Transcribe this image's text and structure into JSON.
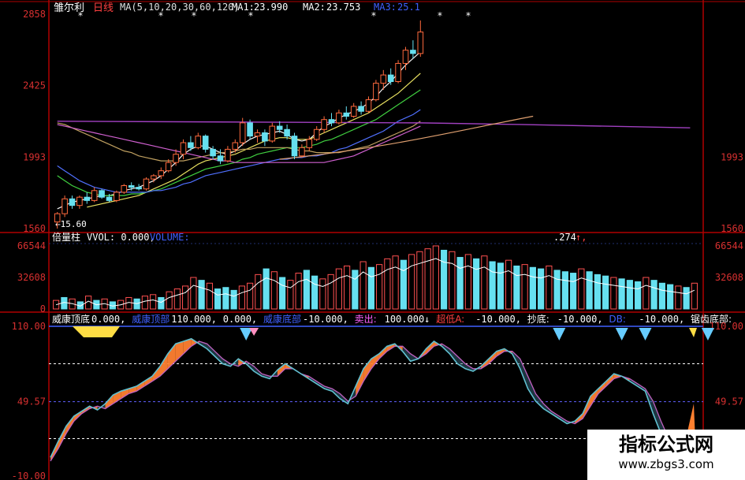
{
  "colors": {
    "bg": "#000000",
    "frame": "#b00000",
    "axis_text": "#d83030",
    "up": "#ff6a3d",
    "down": "#66e0f0",
    "ma5": "#f2f2f2",
    "ma10": "#e8e060",
    "ma20": "#d060d0",
    "ma30": "#40d040",
    "ma60": "#5070ff",
    "ma120": "#c0a060",
    "flat": "#a040c0",
    "kdj_a": "#60c0d0",
    "kdj_b": "#c060c0",
    "fill": "#ff8030",
    "signal": "#66ccff",
    "top_mark": "#ffdd44"
  },
  "header": {
    "stock": "雏尔利",
    "period": "日线",
    "ma_params": "MA(5,10,20,30,60,120)",
    "ma1_label": "MA1:",
    "ma1_value": "23.990",
    "ma2_label": "MA2:",
    "ma2_value": "23.753",
    "ma3_label": "MA3:",
    "ma3_value": "25.1",
    "low_marker": "←15.60"
  },
  "volume_header": {
    "name": "倍量柱",
    "vvol": "VVOL: 0.000,",
    "volume_label": "VOLUME:",
    "right_value": ".274",
    "arrow": "↑,"
  },
  "indicator_header": {
    "items": [
      {
        "label": "威康顶底",
        "value": "0.000,",
        "color": "#ffffff"
      },
      {
        "label": "威康顶部",
        "value": "110.000,",
        "color": "#4060ff"
      },
      {
        "label": "",
        "value": "0.000,",
        "color": "#ffffff"
      },
      {
        "label": "威康底部",
        "value": "-10.000,",
        "color": "#4060ff"
      },
      {
        "label": "卖出:",
        "value": "100.000↓",
        "color": "#ff60ff"
      },
      {
        "label": "超低A:",
        "value": "-10.000,",
        "color": "#ff4040"
      },
      {
        "label": "抄底:",
        "value": "-10.000,",
        "color": "#ffffff"
      },
      {
        "label": "DB:",
        "value": "-10.000,",
        "color": "#4060ff"
      },
      {
        "label": "锯齿底部:",
        "value": "",
        "color": "#ffffff"
      }
    ]
  },
  "watermark": {
    "title": "指标公式网",
    "url": "www.zbgs3.com"
  },
  "chart_data": [
    {
      "type": "candlestick",
      "panel": "price",
      "yticks": [
        "2858",
        "2425",
        "1993",
        "1560"
      ],
      "ylim": [
        15.6,
        28.58
      ],
      "grid": false,
      "candles": [
        {
          "o": 16.0,
          "h": 16.6,
          "l": 15.6,
          "c": 16.5
        },
        {
          "o": 16.5,
          "h": 17.6,
          "l": 16.3,
          "c": 17.4
        },
        {
          "o": 17.4,
          "h": 17.6,
          "l": 16.8,
          "c": 17.0
        },
        {
          "o": 17.0,
          "h": 17.6,
          "l": 16.8,
          "c": 17.5
        },
        {
          "o": 17.5,
          "h": 17.8,
          "l": 17.1,
          "c": 17.3
        },
        {
          "o": 17.3,
          "h": 18.1,
          "l": 17.2,
          "c": 17.9
        },
        {
          "o": 17.9,
          "h": 18.0,
          "l": 17.4,
          "c": 17.5
        },
        {
          "o": 17.5,
          "h": 17.7,
          "l": 17.2,
          "c": 17.3
        },
        {
          "o": 17.3,
          "h": 17.9,
          "l": 17.2,
          "c": 17.8
        },
        {
          "o": 17.8,
          "h": 18.3,
          "l": 17.7,
          "c": 18.2
        },
        {
          "o": 18.2,
          "h": 18.4,
          "l": 17.9,
          "c": 18.1
        },
        {
          "o": 18.1,
          "h": 18.3,
          "l": 17.9,
          "c": 18.0
        },
        {
          "o": 18.0,
          "h": 18.7,
          "l": 17.9,
          "c": 18.6
        },
        {
          "o": 18.6,
          "h": 18.9,
          "l": 18.4,
          "c": 18.8
        },
        {
          "o": 18.8,
          "h": 19.3,
          "l": 18.6,
          "c": 19.1
        },
        {
          "o": 19.1,
          "h": 19.8,
          "l": 19.0,
          "c": 19.6
        },
        {
          "o": 19.6,
          "h": 20.4,
          "l": 19.4,
          "c": 20.1
        },
        {
          "o": 20.1,
          "h": 21.0,
          "l": 19.8,
          "c": 20.8
        },
        {
          "o": 20.8,
          "h": 21.2,
          "l": 20.3,
          "c": 20.5
        },
        {
          "o": 20.5,
          "h": 21.4,
          "l": 20.4,
          "c": 21.2
        },
        {
          "o": 21.2,
          "h": 21.3,
          "l": 20.2,
          "c": 20.4
        },
        {
          "o": 20.4,
          "h": 20.6,
          "l": 19.8,
          "c": 20.0
        },
        {
          "o": 20.0,
          "h": 20.4,
          "l": 19.5,
          "c": 19.7
        },
        {
          "o": 19.7,
          "h": 20.6,
          "l": 19.6,
          "c": 20.4
        },
        {
          "o": 20.4,
          "h": 21.0,
          "l": 20.2,
          "c": 20.8
        },
        {
          "o": 20.8,
          "h": 22.3,
          "l": 20.6,
          "c": 22.0
        },
        {
          "o": 22.0,
          "h": 22.2,
          "l": 21.0,
          "c": 21.2
        },
        {
          "o": 21.2,
          "h": 21.6,
          "l": 20.8,
          "c": 21.4
        },
        {
          "o": 21.4,
          "h": 21.6,
          "l": 20.6,
          "c": 20.9
        },
        {
          "o": 20.9,
          "h": 22.0,
          "l": 20.8,
          "c": 21.8
        },
        {
          "o": 21.8,
          "h": 22.1,
          "l": 21.4,
          "c": 21.6
        },
        {
          "o": 21.6,
          "h": 21.9,
          "l": 21.0,
          "c": 21.2
        },
        {
          "o": 21.2,
          "h": 21.4,
          "l": 19.8,
          "c": 20.0
        },
        {
          "o": 20.0,
          "h": 20.7,
          "l": 19.9,
          "c": 20.5
        },
        {
          "o": 20.5,
          "h": 21.2,
          "l": 20.3,
          "c": 21.0
        },
        {
          "o": 21.0,
          "h": 21.8,
          "l": 20.9,
          "c": 21.6
        },
        {
          "o": 21.6,
          "h": 22.4,
          "l": 21.4,
          "c": 22.2
        },
        {
          "o": 22.2,
          "h": 22.6,
          "l": 21.8,
          "c": 22.0
        },
        {
          "o": 22.0,
          "h": 22.8,
          "l": 21.9,
          "c": 22.6
        },
        {
          "o": 22.6,
          "h": 23.0,
          "l": 22.2,
          "c": 22.4
        },
        {
          "o": 22.4,
          "h": 23.2,
          "l": 22.3,
          "c": 23.0
        },
        {
          "o": 23.0,
          "h": 23.3,
          "l": 22.5,
          "c": 22.7
        },
        {
          "o": 22.7,
          "h": 23.6,
          "l": 22.6,
          "c": 23.4
        },
        {
          "o": 23.4,
          "h": 24.6,
          "l": 23.3,
          "c": 24.4
        },
        {
          "o": 24.4,
          "h": 25.2,
          "l": 24.0,
          "c": 24.9
        },
        {
          "o": 24.9,
          "h": 25.3,
          "l": 24.3,
          "c": 24.5
        },
        {
          "o": 24.5,
          "h": 25.8,
          "l": 24.4,
          "c": 25.6
        },
        {
          "o": 25.6,
          "h": 26.6,
          "l": 25.2,
          "c": 26.4
        },
        {
          "o": 26.4,
          "h": 27.0,
          "l": 25.9,
          "c": 26.2
        },
        {
          "o": 26.2,
          "h": 28.2,
          "l": 26.0,
          "c": 27.5
        }
      ],
      "ma_series": [
        {
          "name": "MA1",
          "values": [
            16.8,
            17.0,
            17.2,
            17.3,
            17.4,
            17.5,
            17.6,
            17.6,
            17.7,
            17.9,
            18.0,
            18.1,
            18.3,
            18.5,
            18.8,
            19.2,
            19.6,
            20.1,
            20.4,
            20.6,
            20.6,
            20.4,
            20.2,
            20.1,
            20.3,
            20.7,
            21.0,
            21.2,
            21.3,
            21.4,
            21.5,
            21.3,
            21.0,
            20.9,
            21.0,
            21.4,
            21.8,
            22.0,
            22.3,
            22.5,
            22.7,
            22.9,
            23.2,
            23.6,
            24.1,
            24.5,
            25.0,
            25.5,
            25.9,
            26.3
          ]
        },
        {
          "name": "MA2",
          "values": [
            null,
            null,
            null,
            null,
            16.9,
            17.0,
            17.1,
            17.2,
            17.3,
            17.4,
            17.5,
            17.6,
            17.8,
            18.0,
            18.2,
            18.4,
            18.6,
            18.9,
            19.2,
            19.5,
            19.7,
            19.8,
            19.9,
            20.0,
            20.1,
            20.3,
            20.5,
            20.7,
            20.9,
            21.0,
            21.1,
            21.1,
            21.0,
            21.0,
            21.0,
            21.2,
            21.4,
            21.6,
            21.8,
            22.0,
            22.2,
            22.4,
            22.6,
            22.9,
            23.2,
            23.5,
            23.8,
            24.2,
            24.6,
            25.0
          ]
        },
        {
          "name": "MA3",
          "values": [
            18.8,
            18.5,
            18.2,
            18.0,
            17.8,
            17.7,
            17.6,
            17.6,
            17.6,
            17.6,
            17.7,
            17.7,
            17.8,
            17.9,
            18.0,
            18.2,
            18.4,
            18.6,
            18.8,
            19.0,
            19.2,
            19.3,
            19.4,
            19.5,
            19.6,
            19.8,
            19.9,
            20.1,
            20.2,
            20.3,
            20.4,
            20.5,
            20.5,
            20.5,
            20.6,
            20.7,
            20.9,
            21.0,
            21.2,
            21.4,
            21.6,
            21.8,
            22.0,
            22.2,
            22.5,
            22.8,
            23.1,
            23.4,
            23.7,
            24.0
          ]
        },
        {
          "name": "MA4",
          "values": [
            19.4,
            19.1,
            18.8,
            18.5,
            18.3,
            18.1,
            18.0,
            17.9,
            17.8,
            17.8,
            17.8,
            17.8,
            17.8,
            17.9,
            17.9,
            18.0,
            18.1,
            18.3,
            18.4,
            18.6,
            18.8,
            18.9,
            19.0,
            19.1,
            19.2,
            19.3,
            19.4,
            19.5,
            19.6,
            19.7,
            19.8,
            19.8,
            19.9,
            19.9,
            20.0,
            20.0,
            20.1,
            20.2,
            20.4,
            20.5,
            20.7,
            20.9,
            21.1,
            21.3,
            21.5,
            21.8,
            22.1,
            22.3,
            22.5,
            22.8
          ]
        },
        {
          "name": "MA5",
          "values": [
            22.0,
            21.9,
            21.7,
            21.5,
            21.3,
            21.1,
            20.9,
            20.7,
            20.5,
            20.3,
            20.2,
            20.0,
            19.9,
            19.8,
            19.7,
            19.7,
            19.7,
            19.7,
            19.8,
            19.9,
            20.0,
            20.1,
            20.2,
            20.2,
            20.3,
            20.4,
            20.4,
            20.5,
            20.5,
            20.5,
            20.5,
            20.5,
            20.4,
            20.3,
            20.3,
            20.2,
            20.2,
            20.2,
            20.2,
            20.3,
            20.4,
            20.5,
            20.6,
            20.8,
            21.0,
            21.2,
            21.4,
            21.6,
            21.8,
            22.1
          ]
        },
        {
          "name": "MA6",
          "values": [
            21.9,
            21.8,
            21.7,
            21.6,
            21.5,
            21.4,
            21.3,
            21.2,
            21.1,
            21.0,
            20.9,
            20.8,
            20.7,
            20.6,
            20.5,
            20.4,
            20.3,
            20.2,
            20.1,
            20.0,
            19.9,
            19.8,
            19.7,
            19.7,
            19.6,
            19.6,
            19.6,
            19.6,
            19.6,
            19.6,
            19.6,
            19.6,
            19.6,
            19.6,
            19.6,
            19.6,
            19.6,
            19.7,
            19.8,
            19.9,
            20.0,
            20.2,
            20.4,
            20.6,
            20.8,
            21.0,
            21.2,
            21.4,
            21.6,
            21.8
          ]
        }
      ],
      "flat_line": [
        [
          0,
          22.1
        ],
        [
          70,
          22.3
        ],
        [
          88,
          21.7
        ]
      ]
    },
    {
      "type": "bar",
      "panel": "volume",
      "yticks": [
        "66544",
        "32608",
        "0"
      ],
      "ylim": [
        0,
        66544
      ],
      "values": [
        6,
        8,
        7,
        5,
        9,
        6,
        7,
        5,
        6,
        8,
        7,
        9,
        10,
        8,
        12,
        14,
        16,
        22,
        20,
        18,
        14,
        15,
        13,
        16,
        18,
        24,
        28,
        26,
        22,
        20,
        25,
        27,
        23,
        21,
        24,
        28,
        30,
        27,
        33,
        29,
        31,
        35,
        37,
        34,
        38,
        40,
        42,
        44,
        41,
        40,
        36,
        38,
        35,
        37,
        33,
        32,
        34,
        30,
        31,
        29,
        28,
        30,
        27,
        26,
        25,
        28,
        26,
        24,
        23,
        22,
        21,
        20,
        19,
        22,
        20,
        18,
        17,
        16,
        15,
        18
      ],
      "up": [
        1,
        0,
        1,
        0,
        1,
        0,
        1,
        0,
        1,
        1,
        0,
        1,
        1,
        0,
        1,
        1,
        1,
        1,
        0,
        1,
        0,
        0,
        0,
        1,
        1,
        1,
        0,
        1,
        0,
        1,
        1,
        0,
        0,
        1,
        1,
        1,
        1,
        0,
        1,
        0,
        1,
        1,
        1,
        0,
        1,
        1,
        1,
        1,
        0,
        1,
        0,
        1,
        0,
        1,
        0,
        0,
        1,
        0,
        1,
        0,
        0,
        1,
        0,
        0,
        0,
        1,
        0,
        0,
        0,
        1,
        0,
        0,
        0,
        1,
        0,
        0,
        0,
        1,
        0,
        1
      ]
    },
    {
      "type": "line",
      "panel": "indicator",
      "yticks": [
        "110.00",
        "49.57",
        "-10.00"
      ],
      "ylim": [
        -10,
        110
      ],
      "series": [
        {
          "name": "A",
          "values": [
            5,
            18,
            30,
            38,
            42,
            46,
            43,
            48,
            55,
            58,
            60,
            62,
            66,
            70,
            78,
            88,
            96,
            98,
            100,
            96,
            92,
            86,
            80,
            78,
            84,
            80,
            74,
            70,
            68,
            75,
            80,
            76,
            72,
            68,
            64,
            60,
            58,
            52,
            48,
            62,
            76,
            84,
            88,
            94,
            96,
            90,
            82,
            84,
            92,
            98,
            94,
            88,
            80,
            76,
            74,
            78,
            84,
            90,
            92,
            88,
            76,
            60,
            50,
            44,
            40,
            36,
            32,
            34,
            40,
            54,
            60,
            66,
            72,
            70,
            66,
            62,
            58,
            40,
            24,
            16,
            12,
            8,
            6,
            4
          ]
        },
        {
          "name": "B",
          "values": [
            2,
            12,
            24,
            34,
            40,
            44,
            46,
            44,
            48,
            52,
            56,
            58,
            62,
            66,
            70,
            76,
            82,
            88,
            94,
            98,
            96,
            90,
            84,
            80,
            78,
            82,
            78,
            72,
            70,
            70,
            76,
            76,
            72,
            70,
            66,
            62,
            60,
            56,
            50,
            54,
            66,
            76,
            84,
            90,
            94,
            94,
            88,
            84,
            88,
            94,
            96,
            92,
            86,
            80,
            76,
            76,
            80,
            86,
            90,
            90,
            84,
            70,
            56,
            48,
            42,
            38,
            34,
            32,
            36,
            46,
            56,
            62,
            68,
            70,
            68,
            64,
            60,
            50,
            34,
            20,
            14,
            10,
            8,
            6
          ]
        }
      ],
      "dashed_levels": [
        80,
        49.57,
        20
      ],
      "top_markers": [
        16,
        41,
        46,
        48,
        53
      ],
      "right_values": [
        20,
        36,
        48
      ]
    }
  ]
}
